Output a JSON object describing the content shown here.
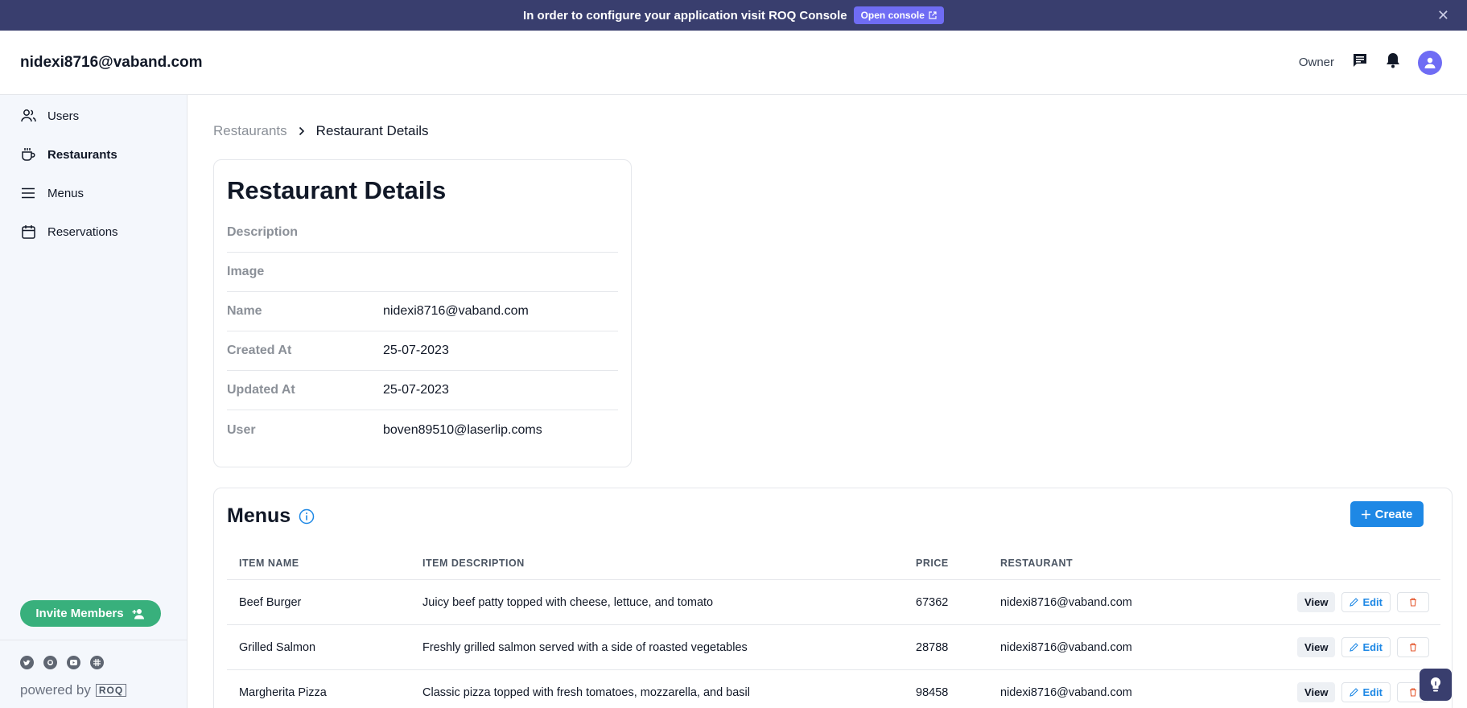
{
  "banner": {
    "message": "In order to configure your application visit ROQ Console",
    "button_label": "Open console"
  },
  "header": {
    "title": "nidexi8716@vaband.com",
    "role": "Owner"
  },
  "sidebar": {
    "items": [
      {
        "label": "Users",
        "icon": "users-icon",
        "active": false
      },
      {
        "label": "Restaurants",
        "icon": "cup-icon",
        "active": true
      },
      {
        "label": "Menus",
        "icon": "menu-lines-icon",
        "active": false
      },
      {
        "label": "Reservations",
        "icon": "calendar-icon",
        "active": false
      }
    ],
    "invite_label": "Invite Members",
    "powered_by": "powered by",
    "powered_logo": "ROQ"
  },
  "breadcrumb": {
    "parent": "Restaurants",
    "current": "Restaurant Details"
  },
  "details": {
    "title": "Restaurant Details",
    "rows": [
      {
        "key": "Description",
        "value": ""
      },
      {
        "key": "Image",
        "value": ""
      },
      {
        "key": "Name",
        "value": "nidexi8716@vaband.com"
      },
      {
        "key": "Created At",
        "value": "25-07-2023"
      },
      {
        "key": "Updated At",
        "value": "25-07-2023"
      },
      {
        "key": "User",
        "value": "boven89510@laserlip.coms"
      }
    ]
  },
  "menus": {
    "title": "Menus",
    "create_label": "Create",
    "columns": [
      "ITEM NAME",
      "ITEM DESCRIPTION",
      "PRICE",
      "RESTAURANT"
    ],
    "rows": [
      {
        "name": "Beef Burger",
        "description": "Juicy beef patty topped with cheese, lettuce, and tomato",
        "price": "67362",
        "restaurant": "nidexi8716@vaband.com"
      },
      {
        "name": "Grilled Salmon",
        "description": "Freshly grilled salmon served with a side of roasted vegetables",
        "price": "28788",
        "restaurant": "nidexi8716@vaband.com"
      },
      {
        "name": "Margherita Pizza",
        "description": "Classic pizza topped with fresh tomatoes, mozzarella, and basil",
        "price": "98458",
        "restaurant": "nidexi8716@vaband.com"
      }
    ],
    "view_label": "View",
    "edit_label": "Edit"
  },
  "colors": {
    "banner_bg": "#393e6e",
    "accent": "#6f6cf4",
    "primary_button": "#1e88e5",
    "invite_button": "#38b07c",
    "sidebar_bg": "#f4f7fc"
  }
}
